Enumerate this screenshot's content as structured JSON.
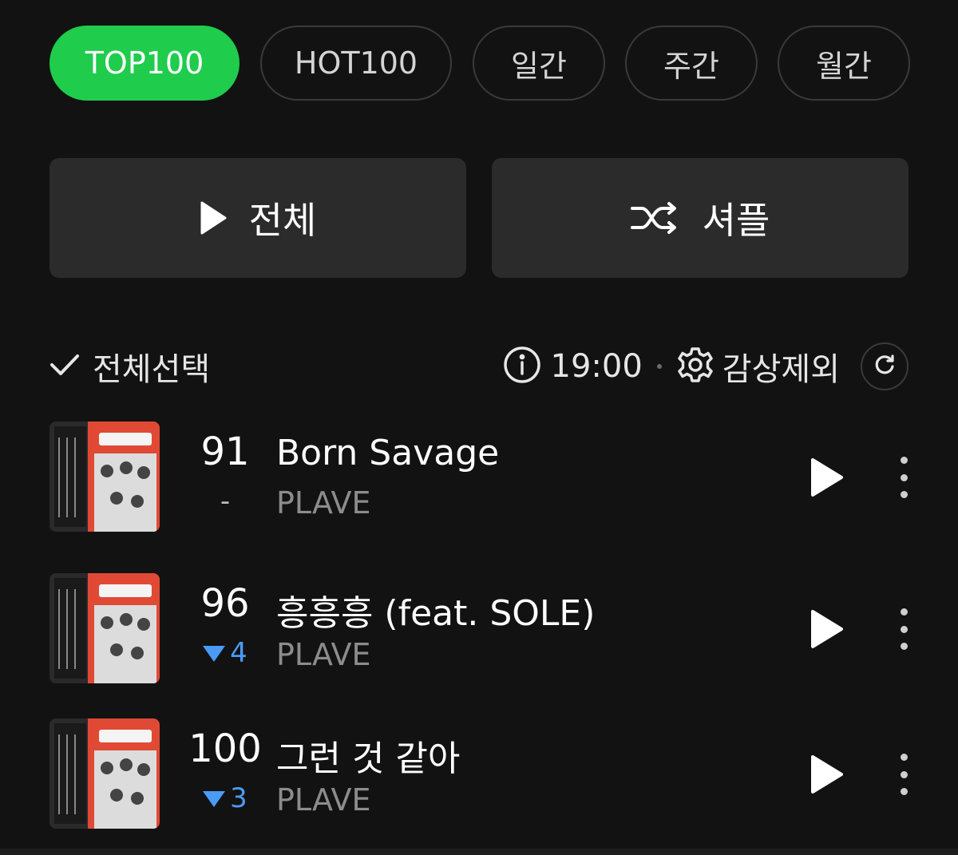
{
  "tabs": [
    "TOP100",
    "HOT100",
    "일간",
    "주간",
    "월간"
  ],
  "active_tab": "TOP100",
  "buttons": {
    "play_all": "전체",
    "shuffle": "셔플"
  },
  "controls": {
    "select_all": "전체선택",
    "time": "19:00",
    "exclude": "감상제외"
  },
  "songs": [
    {
      "rank": "91",
      "change": "-",
      "title": "Born Savage",
      "artist": "PLAVE"
    },
    {
      "rank": "96",
      "change": "4",
      "title": "흥흥흥 (feat. SOLE)",
      "artist": "PLAVE"
    },
    {
      "rank": "100",
      "change": "3",
      "title": "그런 것 같아",
      "artist": "PLAVE"
    }
  ],
  "colors": {
    "accent": "#1fcc4c",
    "down": "#4a9bf5",
    "background": "#121212"
  },
  "icons": [
    "play-icon",
    "shuffle-icon",
    "check-icon",
    "info-icon",
    "gear-icon",
    "refresh-icon",
    "more-icon"
  ]
}
